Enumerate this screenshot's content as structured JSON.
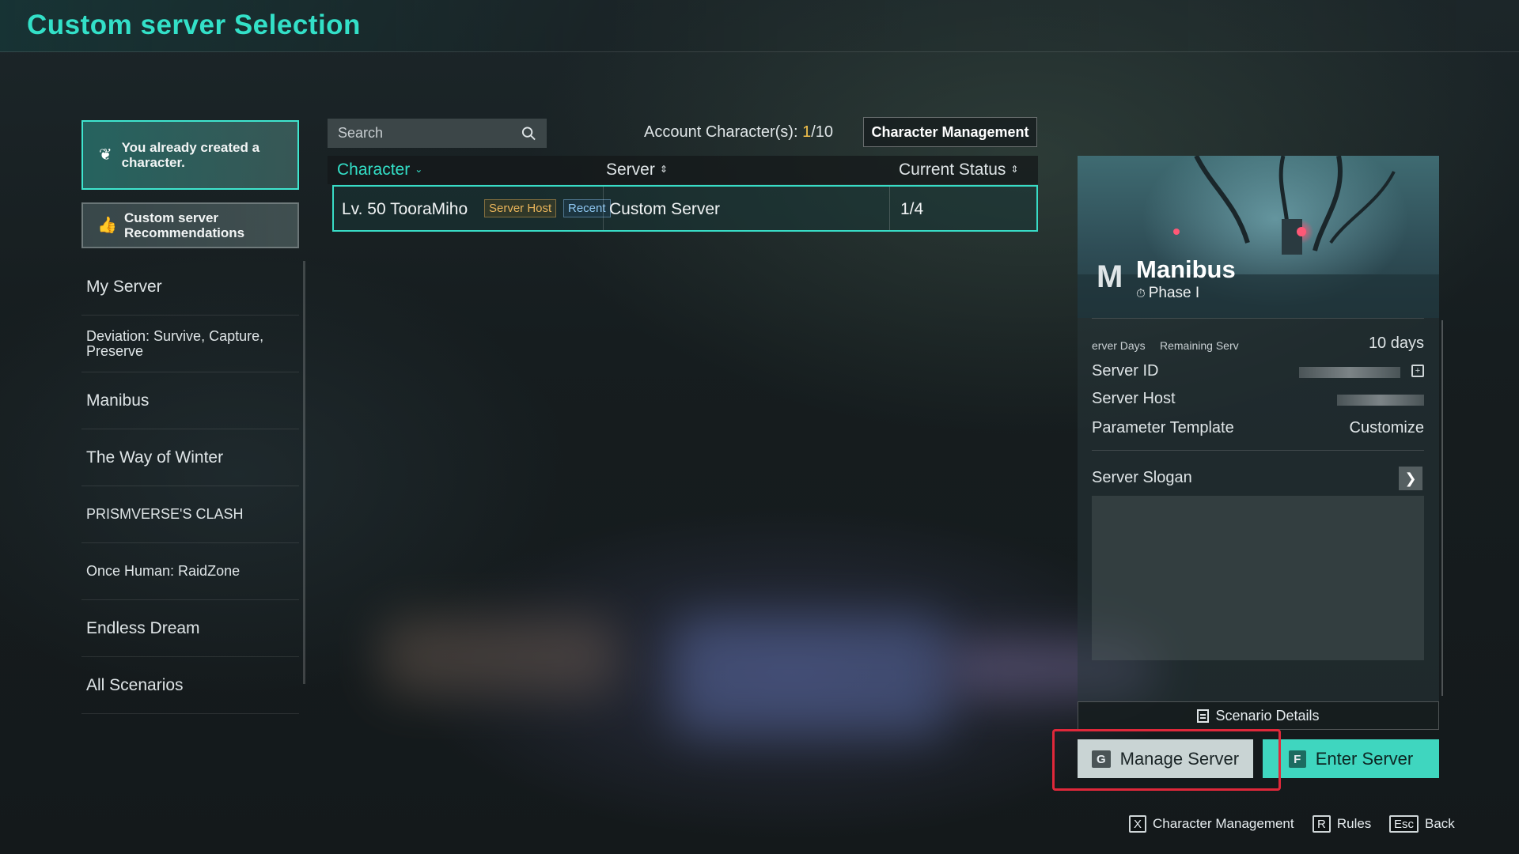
{
  "header": {
    "title": "Custom server Selection"
  },
  "promo": {
    "created": {
      "label": "You already created a character.",
      "icon": "butterfly-icon"
    },
    "recommend": {
      "label": "Custom server Recommendations",
      "icon": "thumbs-up-icon"
    }
  },
  "nav": {
    "items": [
      {
        "label": "My Server"
      },
      {
        "label": "Deviation: Survive, Capture, Preserve"
      },
      {
        "label": "Manibus"
      },
      {
        "label": "The Way of Winter"
      },
      {
        "label": "PRISMVERSE'S CLASH"
      },
      {
        "label": "Once Human: RaidZone"
      },
      {
        "label": "Endless Dream"
      },
      {
        "label": "All Scenarios"
      }
    ]
  },
  "search": {
    "placeholder": "Search",
    "value": ""
  },
  "account": {
    "label": "Account Character(s): ",
    "count": "1",
    "max": "/10",
    "management_button": "Character Management"
  },
  "table": {
    "columns": [
      "Character",
      "Server",
      "Current Status"
    ],
    "rows": [
      {
        "character": "Lv. 50 TooraMiho",
        "tags": [
          "Server Host",
          "Recent"
        ],
        "server": "Custom Server",
        "status": "1/4"
      }
    ]
  },
  "detail": {
    "name": "Manibus",
    "phase": "Phase I",
    "remaining_label_a": "erver Days",
    "remaining_label_b": "Remaining Serv",
    "remaining_value": "10 days",
    "server_id_label": "Server ID",
    "server_host_label": "Server Host",
    "param_label": "Parameter Template",
    "param_value": "Customize",
    "slogan_label": "Server Slogan",
    "scenario_button": "Scenario Details"
  },
  "actions": {
    "manage": {
      "key": "G",
      "label": "Manage Server"
    },
    "enter": {
      "key": "F",
      "label": "Enter Server"
    }
  },
  "footer": {
    "char_mgmt": {
      "key": "X",
      "label": "Character Management"
    },
    "rules": {
      "key": "R",
      "label": "Rules"
    },
    "back": {
      "key": "Esc",
      "label": "Back"
    }
  },
  "colors": {
    "accent": "#33e0c8",
    "highlight": "#e0283a",
    "count": "#f2c04b"
  }
}
